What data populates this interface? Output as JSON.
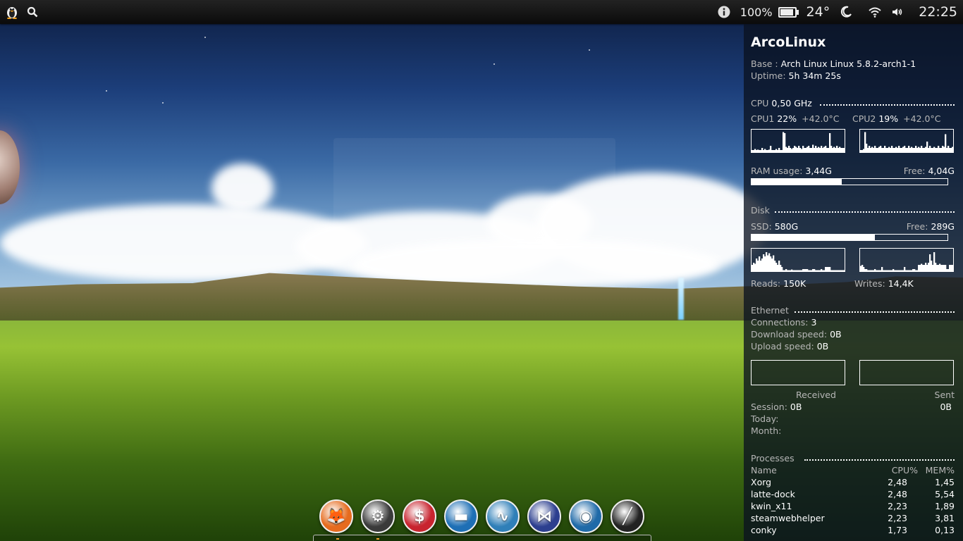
{
  "top_panel": {
    "battery_percent": "100%",
    "battery_level": 1.0,
    "temperature": "24°",
    "clock": "22:25",
    "icons": [
      "tux-icon",
      "search-icon",
      "info-icon",
      "battery-icon",
      "weather-moon-icon",
      "wifi-icon",
      "volume-icon"
    ]
  },
  "conky": {
    "title": "ArcoLinux",
    "base_label": "Base :",
    "base_value": "Arch Linux Linux 5.8.2-arch1-1",
    "uptime_label": "Uptime:",
    "uptime_value": "5h 34m 25s",
    "cpu": {
      "label": "CPU",
      "freq": "0,50 GHz",
      "cpu1_label": "CPU1",
      "cpu1_usage": "22%",
      "cpu1_temp": "+42.0°C",
      "cpu2_label": "CPU2",
      "cpu2_usage": "19%",
      "cpu2_temp": "+42.0°C",
      "cpu1_graph": [
        0.1,
        0.1,
        0.15,
        0.1,
        0.12,
        0.1,
        0.1,
        0.2,
        0.1,
        0.15,
        0.1,
        0.1,
        0.12,
        0.3,
        0.1,
        0.1,
        0.1,
        0.15,
        0.1,
        0.2,
        0.1,
        0.1,
        0.95,
        0.9,
        0.25,
        0.2,
        0.3,
        0.2,
        0.15,
        0.2,
        0.3,
        0.25,
        0.2,
        0.3,
        0.2,
        0.15,
        0.3,
        0.2,
        0.2,
        0.25,
        0.3,
        0.2,
        0.2,
        0.35,
        0.2,
        0.3,
        0.2,
        0.25,
        0.2,
        0.3,
        0.2,
        0.25,
        0.3,
        0.2,
        0.2,
        0.9,
        0.3,
        0.2,
        0.25,
        0.2,
        0.3,
        0.2,
        0.25,
        0.2,
        0.2,
        0.2
      ],
      "cpu2_graph": [
        0.1,
        0.1,
        0.15,
        0.95,
        0.4,
        0.2,
        0.3,
        0.2,
        0.25,
        0.2,
        0.3,
        0.2,
        0.2,
        0.25,
        0.3,
        0.2,
        0.2,
        0.3,
        0.2,
        0.2,
        0.25,
        0.2,
        0.3,
        0.2,
        0.2,
        0.25,
        0.2,
        0.3,
        0.2,
        0.2,
        0.25,
        0.3,
        0.2,
        0.2,
        0.3,
        0.2,
        0.25,
        0.2,
        0.2,
        0.3,
        0.2,
        0.25,
        0.2,
        0.3,
        0.2,
        0.2,
        0.25,
        0.5,
        0.2,
        0.3,
        0.2,
        0.2,
        0.25,
        0.2,
        0.2,
        0.3,
        0.2,
        0.2,
        0.3,
        0.25,
        0.85,
        0.2,
        0.3,
        0.2,
        0.2,
        0.25
      ]
    },
    "ram": {
      "usage_label": "RAM usage:",
      "usage_value": "3,44G",
      "free_label": "Free:",
      "free_value": "4,04G",
      "used_fraction": 0.46
    },
    "disk": {
      "label": "Disk",
      "ssd_label": "SSD:",
      "ssd_value": "580G",
      "free_label": "Free:",
      "free_value": "289G",
      "used_fraction": 0.63,
      "reads_label": "Reads:",
      "reads_value": "150K",
      "writes_label": "Writes:",
      "writes_value": "14,4K",
      "reads_graph": [
        0.3,
        0.4,
        0.35,
        0.6,
        0.5,
        0.7,
        0.5,
        0.6,
        0.8,
        0.7,
        0.9,
        0.75,
        0.85,
        0.7,
        0.6,
        0.75,
        0.5,
        0.4,
        0.3,
        0.5,
        0.3,
        0.2,
        0.05,
        0.05,
        0.1,
        0.05,
        0.05,
        0.05,
        0.08,
        0.05,
        0.05,
        0.05,
        0.05,
        0.05,
        0.05,
        0.05,
        0.1,
        0.1,
        0.1,
        0.1,
        0.05,
        0.05,
        0.05,
        0.1,
        0.1,
        0.05,
        0.05,
        0.05,
        0.05,
        0.1,
        0.05,
        0.05,
        0.2,
        0.2,
        0.2,
        0.2,
        0.05,
        0.05,
        0.05,
        0.05,
        0.05,
        0.05,
        0.05,
        0.05,
        0.05,
        0.05
      ],
      "writes_graph": [
        0.25,
        0.3,
        0.2,
        0.1,
        0.1,
        0.05,
        0.05,
        0.05,
        0.05,
        0.05,
        0.1,
        0.05,
        0.05,
        0.05,
        0.05,
        0.2,
        0.05,
        0.05,
        0.05,
        0.05,
        0.05,
        0.05,
        0.05,
        0.1,
        0.05,
        0.05,
        0.05,
        0.05,
        0.05,
        0.05,
        0.05,
        0.2,
        0.05,
        0.05,
        0.05,
        0.05,
        0.05,
        0.1,
        0.1,
        0.05,
        0.05,
        0.3,
        0.3,
        0.35,
        0.3,
        0.3,
        0.4,
        0.3,
        0.4,
        0.8,
        0.5,
        0.3,
        0.9,
        0.4,
        0.3,
        0.3,
        0.35,
        0.3,
        0.3,
        0.3,
        0.3,
        0.1,
        0.1,
        0.3,
        0.3,
        0.3
      ]
    },
    "ethernet": {
      "label": "Ethernet",
      "connections_label": "Connections:",
      "connections_value": "3",
      "download_label": "Download speed:",
      "download_value": "0B",
      "upload_label": "Upload speed:",
      "upload_value": "0B",
      "received_label": "Received",
      "sent_label": "Sent",
      "session_label": "Session:",
      "session_received": "0B",
      "session_sent": "0B",
      "today_label": "Today:",
      "month_label": "Month:"
    },
    "processes": {
      "label": "Processes",
      "headers": [
        "Name",
        "CPU%",
        "MEM%"
      ],
      "rows": [
        {
          "name": "Xorg",
          "cpu": "2,48",
          "mem": "1,45"
        },
        {
          "name": "latte-dock",
          "cpu": "2,48",
          "mem": "5,54"
        },
        {
          "name": "kwin_x11",
          "cpu": "2,23",
          "mem": "1,89"
        },
        {
          "name": "steamwebhelper",
          "cpu": "2,23",
          "mem": "3,81"
        },
        {
          "name": "conky",
          "cpu": "1,73",
          "mem": "0,13"
        }
      ]
    }
  },
  "dock": {
    "apps": [
      {
        "name": "firefox",
        "icon": "firefox-icon",
        "color": "#e66b1e",
        "glyph": "🦊"
      },
      {
        "name": "steam",
        "icon": "steam-icon",
        "color": "#3a3a3a",
        "glyph": "⚙"
      },
      {
        "name": "finance-app",
        "icon": "dollar-books-icon",
        "color": "#c8242f",
        "glyph": "$"
      },
      {
        "name": "file-manager",
        "icon": "briefcase-icon",
        "color": "#1e6fb5",
        "glyph": "▬"
      },
      {
        "name": "system-monitor",
        "icon": "waveform-icon",
        "color": "#2f7fb8",
        "glyph": "∿"
      },
      {
        "name": "vscode",
        "icon": "vscode-icon",
        "color": "#2c3f8f",
        "glyph": "⋈"
      },
      {
        "name": "eye-app",
        "icon": "eye-icon",
        "color": "#1f6aa8",
        "glyph": "◉"
      },
      {
        "name": "analog-clock",
        "icon": "clock-icon",
        "color": "#222222",
        "glyph": "╱"
      }
    ]
  }
}
